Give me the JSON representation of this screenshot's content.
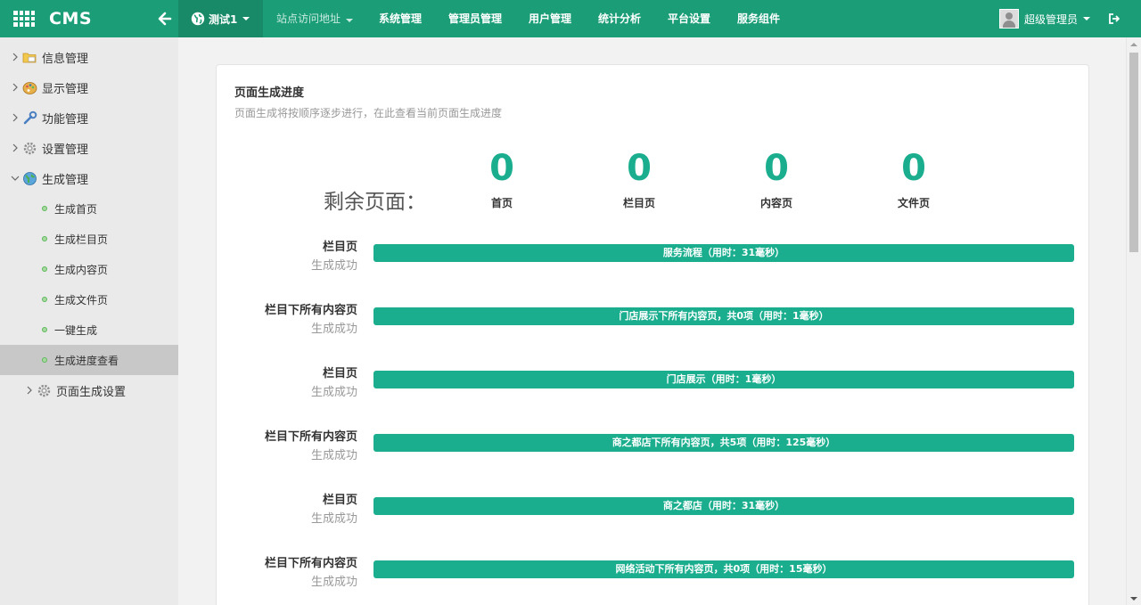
{
  "header": {
    "brand": "CMS",
    "site_selector": "测试1",
    "nav": [
      "站点访问地址",
      "系统管理",
      "管理员管理",
      "用户管理",
      "统计分析",
      "平台设置",
      "服务组件"
    ],
    "user": "超级管理员"
  },
  "sidebar": {
    "items": [
      {
        "label": "信息管理",
        "icon": "folder-icon"
      },
      {
        "label": "显示管理",
        "icon": "palette-icon"
      },
      {
        "label": "功能管理",
        "icon": "wrench-icon"
      },
      {
        "label": "设置管理",
        "icon": "gear-icon"
      },
      {
        "label": "生成管理",
        "icon": "globe-icon"
      }
    ],
    "subitems": [
      "生成首页",
      "生成栏目页",
      "生成内容页",
      "生成文件页",
      "一键生成",
      "生成进度查看"
    ],
    "active_subitem": "生成进度查看",
    "extra_item": "页面生成设置"
  },
  "card": {
    "title": "页面生成进度",
    "subtitle": "页面生成将按顺序逐步进行，在此查看当前页面生成进度",
    "remaining_label": "剩余页面：",
    "counters": [
      {
        "value": "0",
        "label": "首页"
      },
      {
        "value": "0",
        "label": "栏目页"
      },
      {
        "value": "0",
        "label": "内容页"
      },
      {
        "value": "0",
        "label": "文件页"
      }
    ],
    "tasks": [
      {
        "type": "栏目页",
        "status": "生成成功",
        "message": "服务流程（用时：31毫秒）"
      },
      {
        "type": "栏目下所有内容页",
        "status": "生成成功",
        "message": "门店展示下所有内容页，共0项（用时：1毫秒）"
      },
      {
        "type": "栏目页",
        "status": "生成成功",
        "message": "门店展示（用时：1毫秒）"
      },
      {
        "type": "栏目下所有内容页",
        "status": "生成成功",
        "message": "商之都店下所有内容页，共5项（用时：125毫秒）"
      },
      {
        "type": "栏目页",
        "status": "生成成功",
        "message": "商之都店（用时：31毫秒）"
      },
      {
        "type": "栏目下所有内容页",
        "status": "生成成功",
        "message": "网络活动下所有内容页，共0项（用时：15毫秒）"
      }
    ]
  },
  "colors": {
    "header_bg": "#1b9e77",
    "accent": "#1aae8f",
    "sidebar_bg": "#eaeaea",
    "sidebar_active": "#c8c8c8"
  }
}
